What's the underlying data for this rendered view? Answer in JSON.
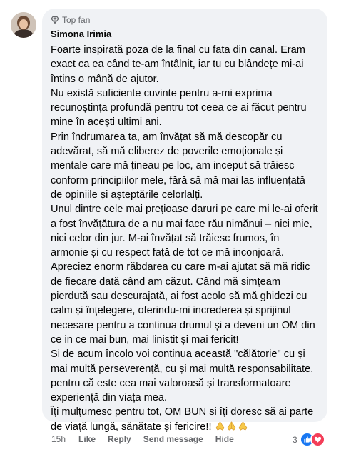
{
  "comment": {
    "badge": "Top fan",
    "author": "Simona Irimia",
    "paragraphs": [
      "Foarte inspirată poza de la final cu fata din canal. Eram exact ca ea când te-am întâlnit, iar tu cu blândețe mi-ai întins o mână de ajutor.",
      "Nu există suficiente cuvinte pentru a-mi exprima recunoștința profundă pentru tot ceea ce ai făcut pentru mine în acești ultimi ani.",
      "Prin îndrumarea ta, am învățat să mă descopăr cu adevărat, să mă eliberez de poverile emoționale și mentale care mă țineau pe loc, am inceput să trăiesc conform principiilor mele, fără să mă mai las influențată de opiniile și așteptările celorlalți.",
      "Unul dintre cele mai prețioase daruri pe care mi le-ai oferit a fost învățătura de a nu mai face rău nimănui – nici mie, nici celor din jur. M-ai învățat să trăiesc frumos, în armonie și cu respect față de tot ce mă inconjoară.",
      "Apreciez enorm răbdarea cu care m-ai ajutat să mă ridic de fiecare dată când am căzut. Când mă simțeam pierdută sau descurajată, ai fost acolo să mă ghidezi cu calm și înțelegere, oferindu-mi increderea și sprijinul necesare pentru a continua drumul și a deveni un OM din ce in ce mai bun, mai linistit și mai fericit!",
      "Si de acum încolo voi continua această \"călătorie\" cu și mai multă perseverență, cu și mai multă responsabilitate, pentru că este cea mai valoroasă și transformatoare experiență din viața mea.",
      "Îți mulțumesc pentru tot, OM BUN si îți doresc să ai parte de viață lungă, sănătate și fericire!!"
    ],
    "emoji_icon": "folded-hands-icon"
  },
  "actions": {
    "time": "15h",
    "like": "Like",
    "reply": "Reply",
    "send_message": "Send message",
    "hide": "Hide"
  },
  "reactions": {
    "count": "3",
    "icons": [
      "like-reaction-icon",
      "love-reaction-icon"
    ],
    "colors": {
      "like": "#1877f2",
      "love": "#f33e58"
    }
  }
}
